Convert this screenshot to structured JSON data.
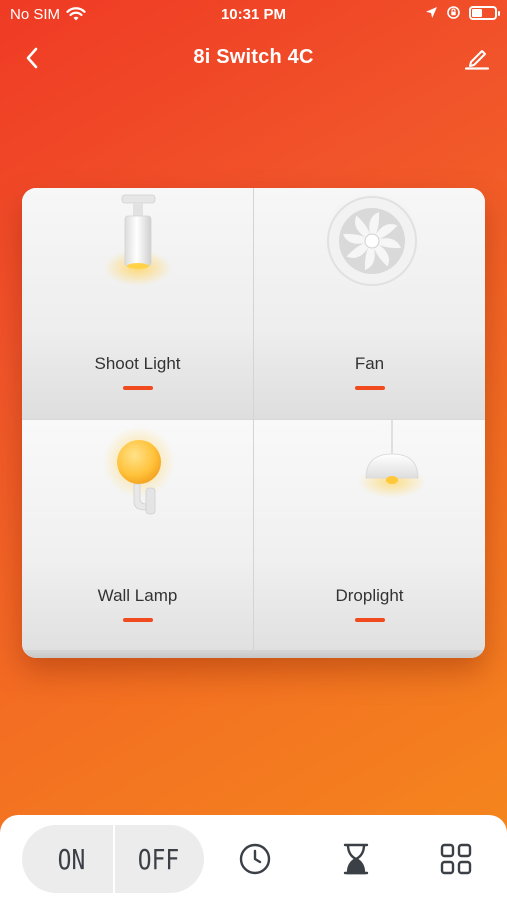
{
  "status_bar": {
    "carrier": "No SIM",
    "time": "10:31 PM"
  },
  "nav": {
    "title": "8i Switch 4C"
  },
  "switch_panel": {
    "gangs": [
      {
        "label": "Shoot Light",
        "icon": "shoot-light-icon"
      },
      {
        "label": "Fan",
        "icon": "fan-icon"
      },
      {
        "label": "Wall Lamp",
        "icon": "wall-lamp-icon"
      },
      {
        "label": "Droplight",
        "icon": "droplight-icon"
      }
    ],
    "indicator_color": "#f24a1f"
  },
  "bottom_bar": {
    "on_label": "ON",
    "off_label": "OFF",
    "tools": [
      "clock-icon",
      "hourglass-icon",
      "grid-icon"
    ]
  },
  "colors": {
    "accent": "#f24a1f",
    "gradient_start": "#ef3a24",
    "gradient_end": "#f4891d"
  }
}
